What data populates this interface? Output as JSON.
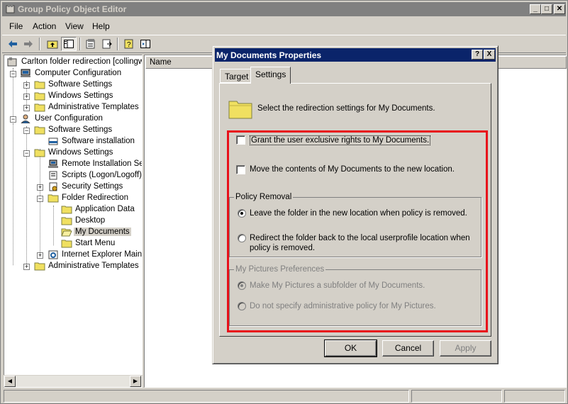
{
  "window": {
    "title": "Group Policy Object Editor"
  },
  "menu": {
    "file": "File",
    "action": "Action",
    "view": "View",
    "help": "Help"
  },
  "tree": {
    "root": "Carlton folder redirection [collingwo",
    "computer_config": "Computer Configuration",
    "cc_software": "Software Settings",
    "cc_windows": "Windows Settings",
    "cc_admin": "Administrative Templates",
    "user_config": "User Configuration",
    "uc_software": "Software Settings",
    "uc_software_install": "Software installation",
    "uc_windows": "Windows Settings",
    "uc_remote": "Remote Installation Ser",
    "uc_scripts": "Scripts (Logon/Logoff)",
    "uc_security": "Security Settings",
    "uc_folder_redir": "Folder Redirection",
    "uc_appdata": "Application Data",
    "uc_desktop": "Desktop",
    "uc_mydocs": "My Documents",
    "uc_startmenu": "Start Menu",
    "uc_ie": "Internet Explorer Maint",
    "uc_admin": "Administrative Templates"
  },
  "right_pane": {
    "col_name": "Name"
  },
  "dialog": {
    "title": "My Documents Properties",
    "tab_target": "Target",
    "tab_settings": "Settings",
    "header": "Select the redirection settings for My Documents.",
    "grant_rights": "Grant the user exclusive rights to My Documents.",
    "move_contents": "Move the contents of My Documents to the new location.",
    "policy_removal_label": "Policy Removal",
    "leave_folder": "Leave the folder in the new location when policy is removed.",
    "redirect_back_1": "Redirect the folder back to the local userprofile location when",
    "redirect_back_2": "policy is removed.",
    "pictures_label": "My Pictures Preferences",
    "pictures_subfolder": "Make My Pictures a subfolder of My Documents.",
    "pictures_nopolicy": "Do not specify administrative policy for My Pictures.",
    "ok": "OK",
    "cancel": "Cancel",
    "apply": "Apply",
    "help_glyph": "?",
    "close_glyph": "X"
  }
}
